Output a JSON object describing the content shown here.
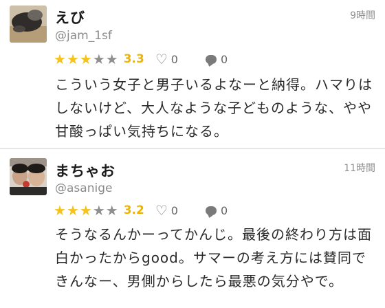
{
  "reviews": [
    {
      "name": "えび",
      "handle": "@jam_1sf",
      "time": "9時間",
      "score": "3.3",
      "likes": "0",
      "comments": "0",
      "stars_filled": 3,
      "text": "こういう女子と男子いるよなーと納得。ハマりはしないけど、大人なような子どものような、やや甘酸っぱい気持ちになる。"
    },
    {
      "name": "まちゃお",
      "handle": "@asanige",
      "time": "11時間",
      "score": "3.2",
      "likes": "0",
      "comments": "0",
      "stars_filled": 3,
      "text": "そうなるんかーってかんじ。最後の終わり方は面白かったからgood。サマーの考え方には賛同できんなー、男側からしたら最悪の気分やで。"
    }
  ],
  "colors": {
    "star_on": "#f6c21c",
    "star_off": "#8f8f8f",
    "score": "#f0b400"
  },
  "icons": {
    "like": "heart-icon",
    "comment": "speech-bubble-icon",
    "star": "star-icon"
  }
}
